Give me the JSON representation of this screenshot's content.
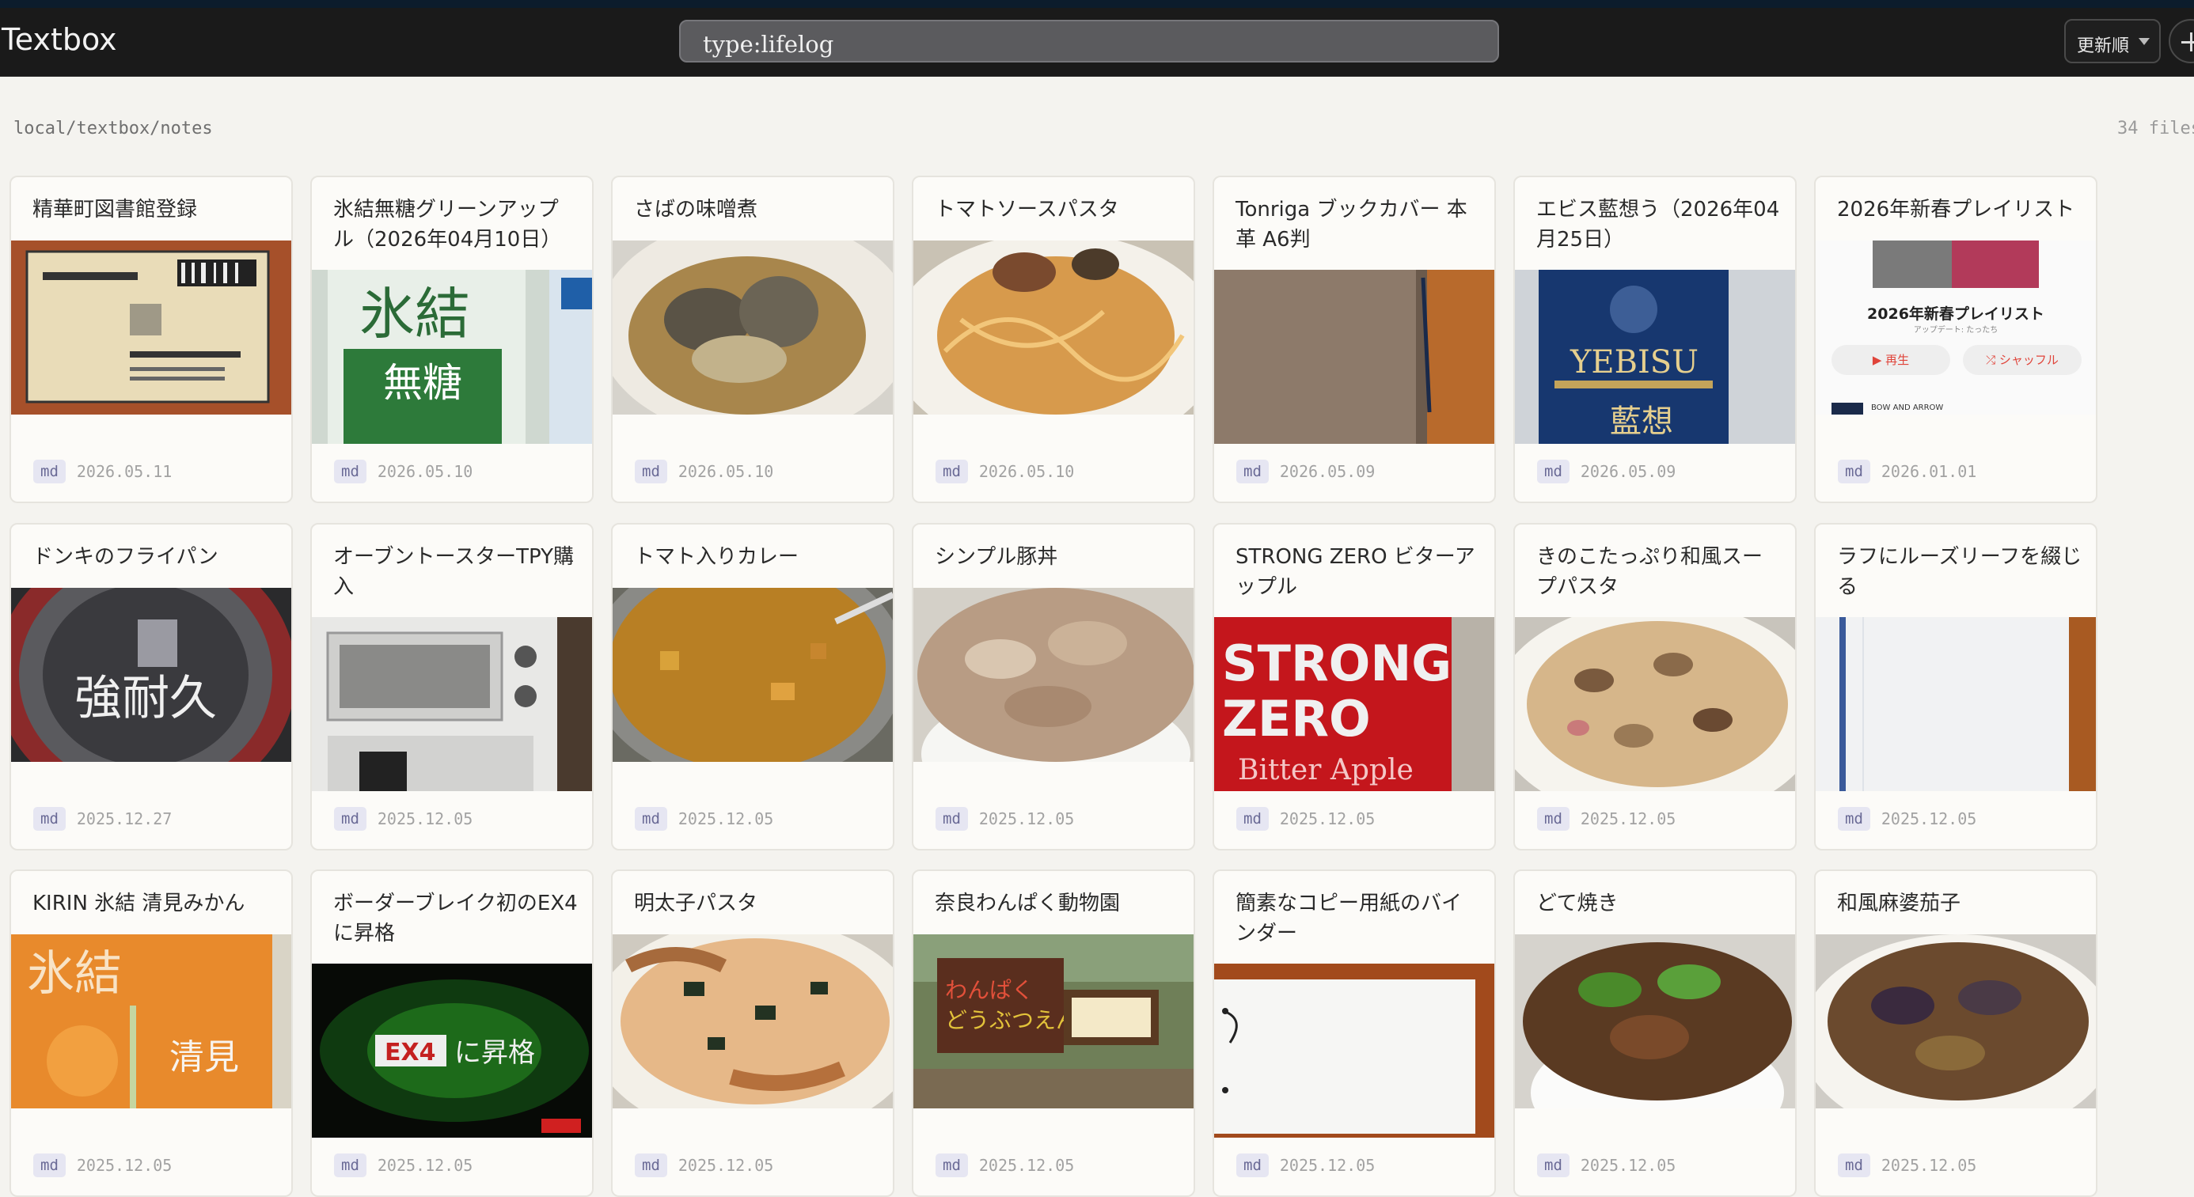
{
  "app": {
    "title": "Textbox"
  },
  "search": {
    "value": "type:lifelog"
  },
  "toolbar": {
    "sort_label": "更新順"
  },
  "location": {
    "path": "local/textbox/notes",
    "count_label": "34 files"
  },
  "colors": {
    "header_bg": "#1a1a1a",
    "page_bg": "#f4f3ef",
    "tag_bg": "#e6e6f2"
  },
  "cards": [
    {
      "title": "精華町図書館登録",
      "type": "md",
      "date": "2026.05.11",
      "thumb": "library-card"
    },
    {
      "title": "氷結無糖グリーンアップル（2026年04月10日）",
      "type": "md",
      "date": "2026.05.10",
      "thumb": "green-can"
    },
    {
      "title": "さばの味噌煮",
      "type": "md",
      "date": "2026.05.10",
      "thumb": "miso-fish"
    },
    {
      "title": "トマトソースパスタ",
      "type": "md",
      "date": "2026.05.10",
      "thumb": "pasta-red"
    },
    {
      "title": "Tonriga ブックカバー 本革 A6判",
      "type": "md",
      "date": "2026.05.09",
      "thumb": "leather-cover"
    },
    {
      "title": "エビス藍想う（2026年04月25日）",
      "type": "md",
      "date": "2026.05.09",
      "thumb": "blue-can"
    },
    {
      "title": "2026年新春プレイリスト",
      "type": "md",
      "date": "2026.01.01",
      "thumb": "playlist",
      "playlist": {
        "heading": "2026年新春プレイリスト",
        "sub": "アップデート: たったち",
        "play": "▶ 再生",
        "shuffle": "⤮ シャッフル",
        "track": "BOW AND ARROW"
      }
    },
    {
      "title": "ドンキのフライパン",
      "type": "md",
      "date": "2025.12.27",
      "thumb": "frying-pan"
    },
    {
      "title": "オーブントースターTPY購入",
      "type": "md",
      "date": "2025.12.05",
      "thumb": "toaster"
    },
    {
      "title": "トマト入りカレー",
      "type": "md",
      "date": "2025.12.05",
      "thumb": "curry"
    },
    {
      "title": "シンプル豚丼",
      "type": "md",
      "date": "2025.12.05",
      "thumb": "pork-bowl"
    },
    {
      "title": "STRONG ZERO ビターアップル",
      "type": "md",
      "date": "2025.12.05",
      "thumb": "red-can"
    },
    {
      "title": "きのこたっぷり和風スープパスタ",
      "type": "md",
      "date": "2025.12.05",
      "thumb": "mushroom-pasta"
    },
    {
      "title": "ラフにルーズリーフを綴じる",
      "type": "md",
      "date": "2025.12.05",
      "thumb": "loose-leaf"
    },
    {
      "title": "KIRIN 氷結 清見みかん",
      "type": "md",
      "date": "2025.12.05",
      "thumb": "orange-can"
    },
    {
      "title": "ボーダーブレイク初のEX4に昇格",
      "type": "md",
      "date": "2025.12.05",
      "thumb": "game-screen"
    },
    {
      "title": "明太子パスタ",
      "type": "md",
      "date": "2025.12.05",
      "thumb": "mentaiko"
    },
    {
      "title": "奈良わんぱく動物園",
      "type": "md",
      "date": "2025.12.05",
      "thumb": "zoo-sign"
    },
    {
      "title": "簡素なコピー用紙のバインダー",
      "type": "md",
      "date": "2025.12.05",
      "thumb": "paper-binder"
    },
    {
      "title": "どて焼き",
      "type": "md",
      "date": "2025.12.05",
      "thumb": "doteyaki"
    },
    {
      "title": "和風麻婆茄子",
      "type": "md",
      "date": "2025.12.05",
      "thumb": "mabo-nasu"
    }
  ]
}
